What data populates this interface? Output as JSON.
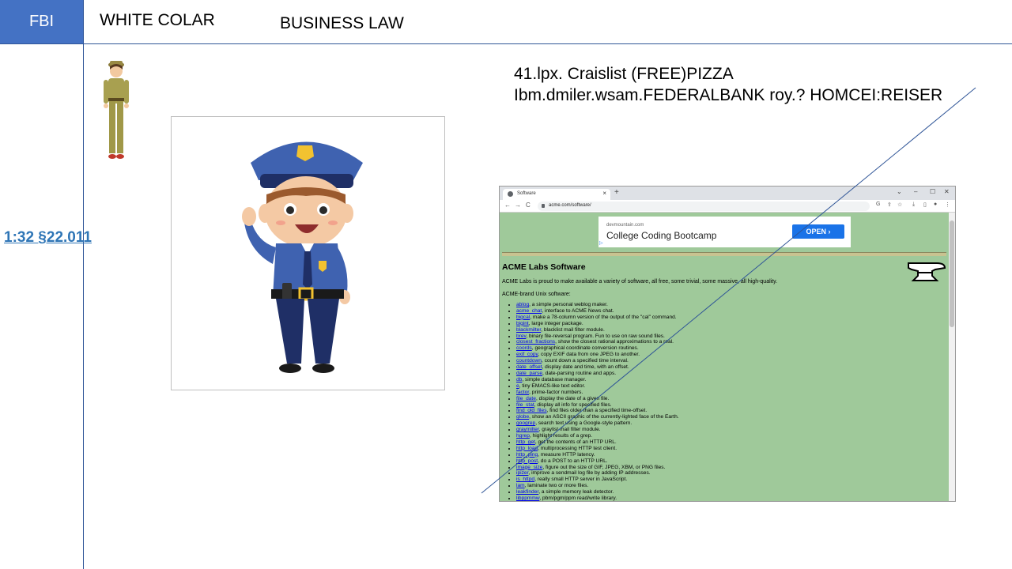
{
  "header": {
    "fbi": "FBI",
    "white_colar": "WHITE COLAR",
    "business_law": "BUSINESS LAW"
  },
  "side_link": "1:32 §22.011",
  "notes": {
    "line1": "41.lpx. Craislist (FREE)PIZZA",
    "line2": "Ibm.dmiler.wsam.FEDERALBANK roy.? HOMCEI:REISER"
  },
  "colors": {
    "accent_blue": "#4472c4",
    "line_blue": "#2f5597",
    "page_green": "#9fc99a",
    "link_blue": "#0000ee"
  },
  "browser": {
    "tab_title": "Software",
    "tab_close": "×",
    "new_tab": "+",
    "win_controls": [
      "⌄",
      "–",
      "☐",
      "✕"
    ],
    "url": "acme.com/software/",
    "nav": [
      "←",
      "→",
      "C"
    ],
    "ad": {
      "domain": "devmountain.com",
      "title": "College Coding Bootcamp",
      "button": "OPEN ›",
      "mark": "▷"
    },
    "page_title": "ACME Labs Software",
    "intro": "ACME Labs is proud to make available a variety of software, all free, some trivial, some massive, all high-quality.",
    "subheading": "ACME-brand Unix software:",
    "items": [
      {
        "name": "ablog",
        "desc": ", a simple personal weblog maker."
      },
      {
        "name": "acme_chat",
        "desc": ", interface to ACME News chat."
      },
      {
        "name": "bigcal",
        "desc": ", make a 78-column version of the output of the \"cal\" command."
      },
      {
        "name": "bigint",
        "desc": ", large integer package."
      },
      {
        "name": "blackmilter",
        "desc": ", blacklist mail filter module."
      },
      {
        "name": "brev",
        "desc": ", binary file-reversal program. Fun to use on raw sound files."
      },
      {
        "name": "closest_fractions",
        "desc": ", show the closest rational approximations to a real."
      },
      {
        "name": "coords",
        "desc": ", geographical coordinate conversion routines."
      },
      {
        "name": "exif_copy",
        "desc": ", copy EXIF data from one JPEG to another."
      },
      {
        "name": "countdown",
        "desc": ", count down a specified time interval."
      },
      {
        "name": "date_offset",
        "desc": ", display date and time, with an offset."
      },
      {
        "name": "date_parse",
        "desc": ", date-parsing routine and apps."
      },
      {
        "name": "db",
        "desc": ", simple database manager."
      },
      {
        "name": "e",
        "desc": ", tiny EMACS-like text editor."
      },
      {
        "name": "factor",
        "desc": ", prime-factor numbers."
      },
      {
        "name": "file_date",
        "desc": ", display the date of a given file."
      },
      {
        "name": "file_stat",
        "desc": ", display all info for specified files."
      },
      {
        "name": "find_old_files",
        "desc": ", find files older than a specified time-offset."
      },
      {
        "name": "globe",
        "desc": ", show an ASCII graphic of the currently-lighted face of the Earth."
      },
      {
        "name": "googrep",
        "desc": ", search text using a Google-style pattern."
      },
      {
        "name": "graymilter",
        "desc": ", graylist mail filter module."
      },
      {
        "name": "hgrep",
        "desc": ", highlight results of a grep."
      },
      {
        "name": "http_get",
        "desc": ", get the contents of an HTTP URL."
      },
      {
        "name": "http_load",
        "desc": ", multiprocessing HTTP test client."
      },
      {
        "name": "http_ping",
        "desc": ", measure HTTP latency."
      },
      {
        "name": "http_post",
        "desc": ", do a POST to an HTTP URL."
      },
      {
        "name": "image_size",
        "desc": ", figure out the size of GIF, JPEG, XBM, or PNG files."
      },
      {
        "name": "ipizer",
        "desc": ", improve a sendmail log file by adding IP addresses."
      },
      {
        "name": "is_httpd",
        "desc": ", really small HTTP server in JavaScript."
      },
      {
        "name": "lam",
        "desc": ", laminate two or more files."
      },
      {
        "name": "leakfinder",
        "desc": ", a simple memory leak detector."
      },
      {
        "name": "libppmmw",
        "desc": ", pbm/pgm/ppm read/write library."
      }
    ]
  }
}
